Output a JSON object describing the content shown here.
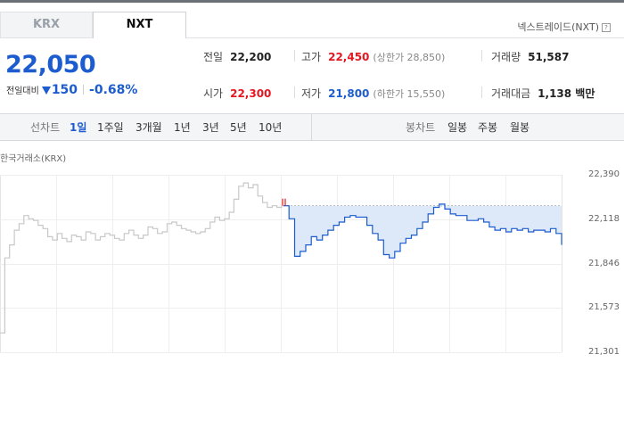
{
  "tabs": [
    {
      "label": "KRX",
      "active": false
    },
    {
      "label": "NXT",
      "active": true
    }
  ],
  "nxt_link": {
    "label": "넥스트레이드(NXT)",
    "icon": "help-icon",
    "icon_glyph": "?"
  },
  "quote": {
    "price": "22,050",
    "change_label": "전일대비",
    "change_direction": "down",
    "change": "150",
    "change_percent": "-0.68%"
  },
  "stats": {
    "prev_close": {
      "label": "전일",
      "value": "22,200"
    },
    "open": {
      "label": "시가",
      "value": "22,300"
    },
    "high": {
      "label": "고가",
      "value": "22,450",
      "note": "(상한가 28,850)"
    },
    "low": {
      "label": "저가",
      "value": "21,800",
      "note": "(하한가 15,550)"
    },
    "volume": {
      "label": "거래량",
      "value": "51,587"
    },
    "trade_value": {
      "label": "거래대금",
      "value": "1,138 백만"
    }
  },
  "period_bar": {
    "line_label": "선차트",
    "line_periods": [
      "1일",
      "1주일",
      "3개월",
      "1년",
      "3년",
      "5년",
      "10년"
    ],
    "active_period": "1일",
    "candle_label": "봉차트",
    "candle_periods": [
      "일봉",
      "주봉",
      "월봉"
    ]
  },
  "colors": {
    "accent_blue": "#1c5ccf",
    "up_red": "#e5161f",
    "krx_line": "#c8c8c8",
    "area_fill": "#dde9f8"
  },
  "chart_data": {
    "type": "line",
    "title": "한국거래소(KRX)",
    "y_ticks": [
      "22,390",
      "22,118",
      "21,846",
      "21,573",
      "21,301"
    ],
    "ylim": [
      21301,
      22390
    ],
    "reference_line": 22200,
    "grid": true,
    "series": [
      {
        "session": "KRX",
        "color": "#c8c8c8",
        "values": [
          21420,
          21880,
          21960,
          22050,
          22090,
          22140,
          22120,
          22110,
          22080,
          22060,
          22010,
          21990,
          22030,
          22000,
          21980,
          22020,
          22010,
          21990,
          22040,
          22030,
          21990,
          22010,
          22030,
          22020,
          22000,
          21990,
          22030,
          22050,
          22020,
          22000,
          22020,
          22070,
          22060,
          22030,
          22040,
          22090,
          22100,
          22080,
          22060,
          22050,
          22040,
          22030,
          22040,
          22060,
          22100,
          22130,
          22110,
          22120,
          22160,
          22240,
          22320,
          22340,
          22310,
          22330,
          22260,
          22220,
          22190,
          22200,
          22190,
          22200
        ]
      },
      {
        "session": "NXT",
        "color": "#1c5ccf",
        "values": [
          22200,
          22120,
          21890,
          21920,
          21960,
          22010,
          21990,
          22020,
          22050,
          22080,
          22100,
          22130,
          22140,
          22130,
          22130,
          22080,
          22030,
          21990,
          21900,
          21880,
          21920,
          21970,
          22000,
          22020,
          22060,
          22100,
          22150,
          22190,
          22210,
          22180,
          22150,
          22140,
          22140,
          22110,
          22110,
          22120,
          22100,
          22070,
          22050,
          22060,
          22040,
          22060,
          22050,
          22060,
          22040,
          22050,
          22050,
          22040,
          22060,
          22030,
          21960
        ]
      }
    ]
  }
}
